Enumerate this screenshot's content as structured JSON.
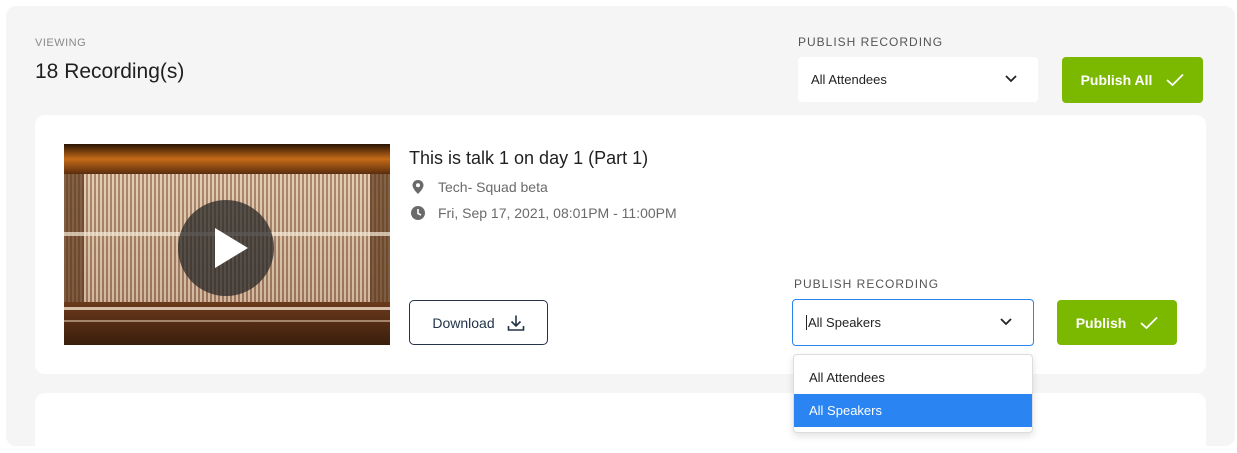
{
  "header": {
    "viewing_label": "VIEWING",
    "count": "18 Recording(s)",
    "publish_label": "PUBLISH RECORDING",
    "publish_select_value": "All Attendees",
    "publish_all_label": "Publish All"
  },
  "recording": {
    "title": "This is talk 1 on day 1 (Part 1)",
    "location": "Tech- Squad beta",
    "datetime": "Fri, Sep 17, 2021, 08:01PM - 11:00PM",
    "download_label": "Download",
    "publish_label": "PUBLISH RECORDING",
    "publish_select_value": "All Speakers",
    "publish_button_label": "Publish",
    "dropdown_options": [
      {
        "label": "All Attendees",
        "selected": false
      },
      {
        "label": "All Speakers",
        "selected": true
      }
    ]
  },
  "colors": {
    "accent_green": "#7bb800",
    "select_focus_border": "#2a84f2",
    "option_selected_bg": "#2a84f2",
    "download_border": "#233449"
  },
  "icons": [
    "chevron-down-icon",
    "check-icon",
    "location-pin-icon",
    "clock-icon",
    "download-icon",
    "play-icon"
  ]
}
